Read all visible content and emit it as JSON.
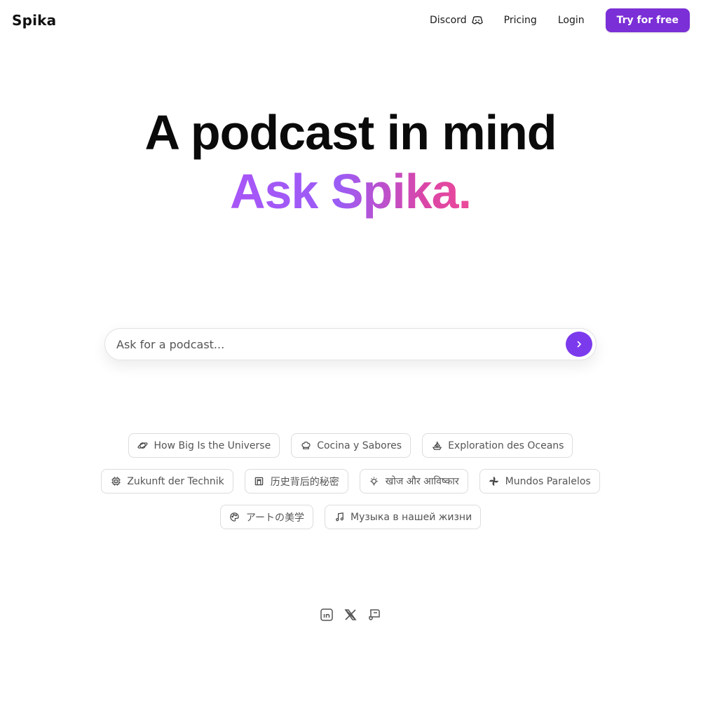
{
  "header": {
    "logo": "Spika",
    "nav": {
      "discord": "Discord",
      "pricing": "Pricing",
      "login": "Login",
      "cta": "Try for free"
    }
  },
  "hero": {
    "title": "A podcast in mind",
    "subtitle": "Ask Spika."
  },
  "search": {
    "placeholder": "Ask for a podcast..."
  },
  "suggestions": [
    {
      "label": "How Big Is the Universe",
      "icon": "planet-icon"
    },
    {
      "label": "Cocina y Sabores",
      "icon": "chef-hat-icon"
    },
    {
      "label": "Exploration des Oceans",
      "icon": "ship-icon"
    },
    {
      "label": "Zukunft der Technik",
      "icon": "cpu-icon"
    },
    {
      "label": "历史背后的秘密",
      "icon": "landmark-icon"
    },
    {
      "label": "खोज और आविष्कार",
      "icon": "lightbulb-icon"
    },
    {
      "label": "Mundos Paralelos",
      "icon": "spiral-icon"
    },
    {
      "label": "アートの美学",
      "icon": "palette-icon"
    },
    {
      "label": "Музыка в нашей жизни",
      "icon": "music-icon"
    }
  ],
  "footer": {
    "socials": [
      "linkedin-icon",
      "x-icon",
      "blog-icon"
    ]
  },
  "colors": {
    "accent": "#7b2fd6",
    "gradient_start": "#a855f7",
    "gradient_end": "#ec4899"
  }
}
